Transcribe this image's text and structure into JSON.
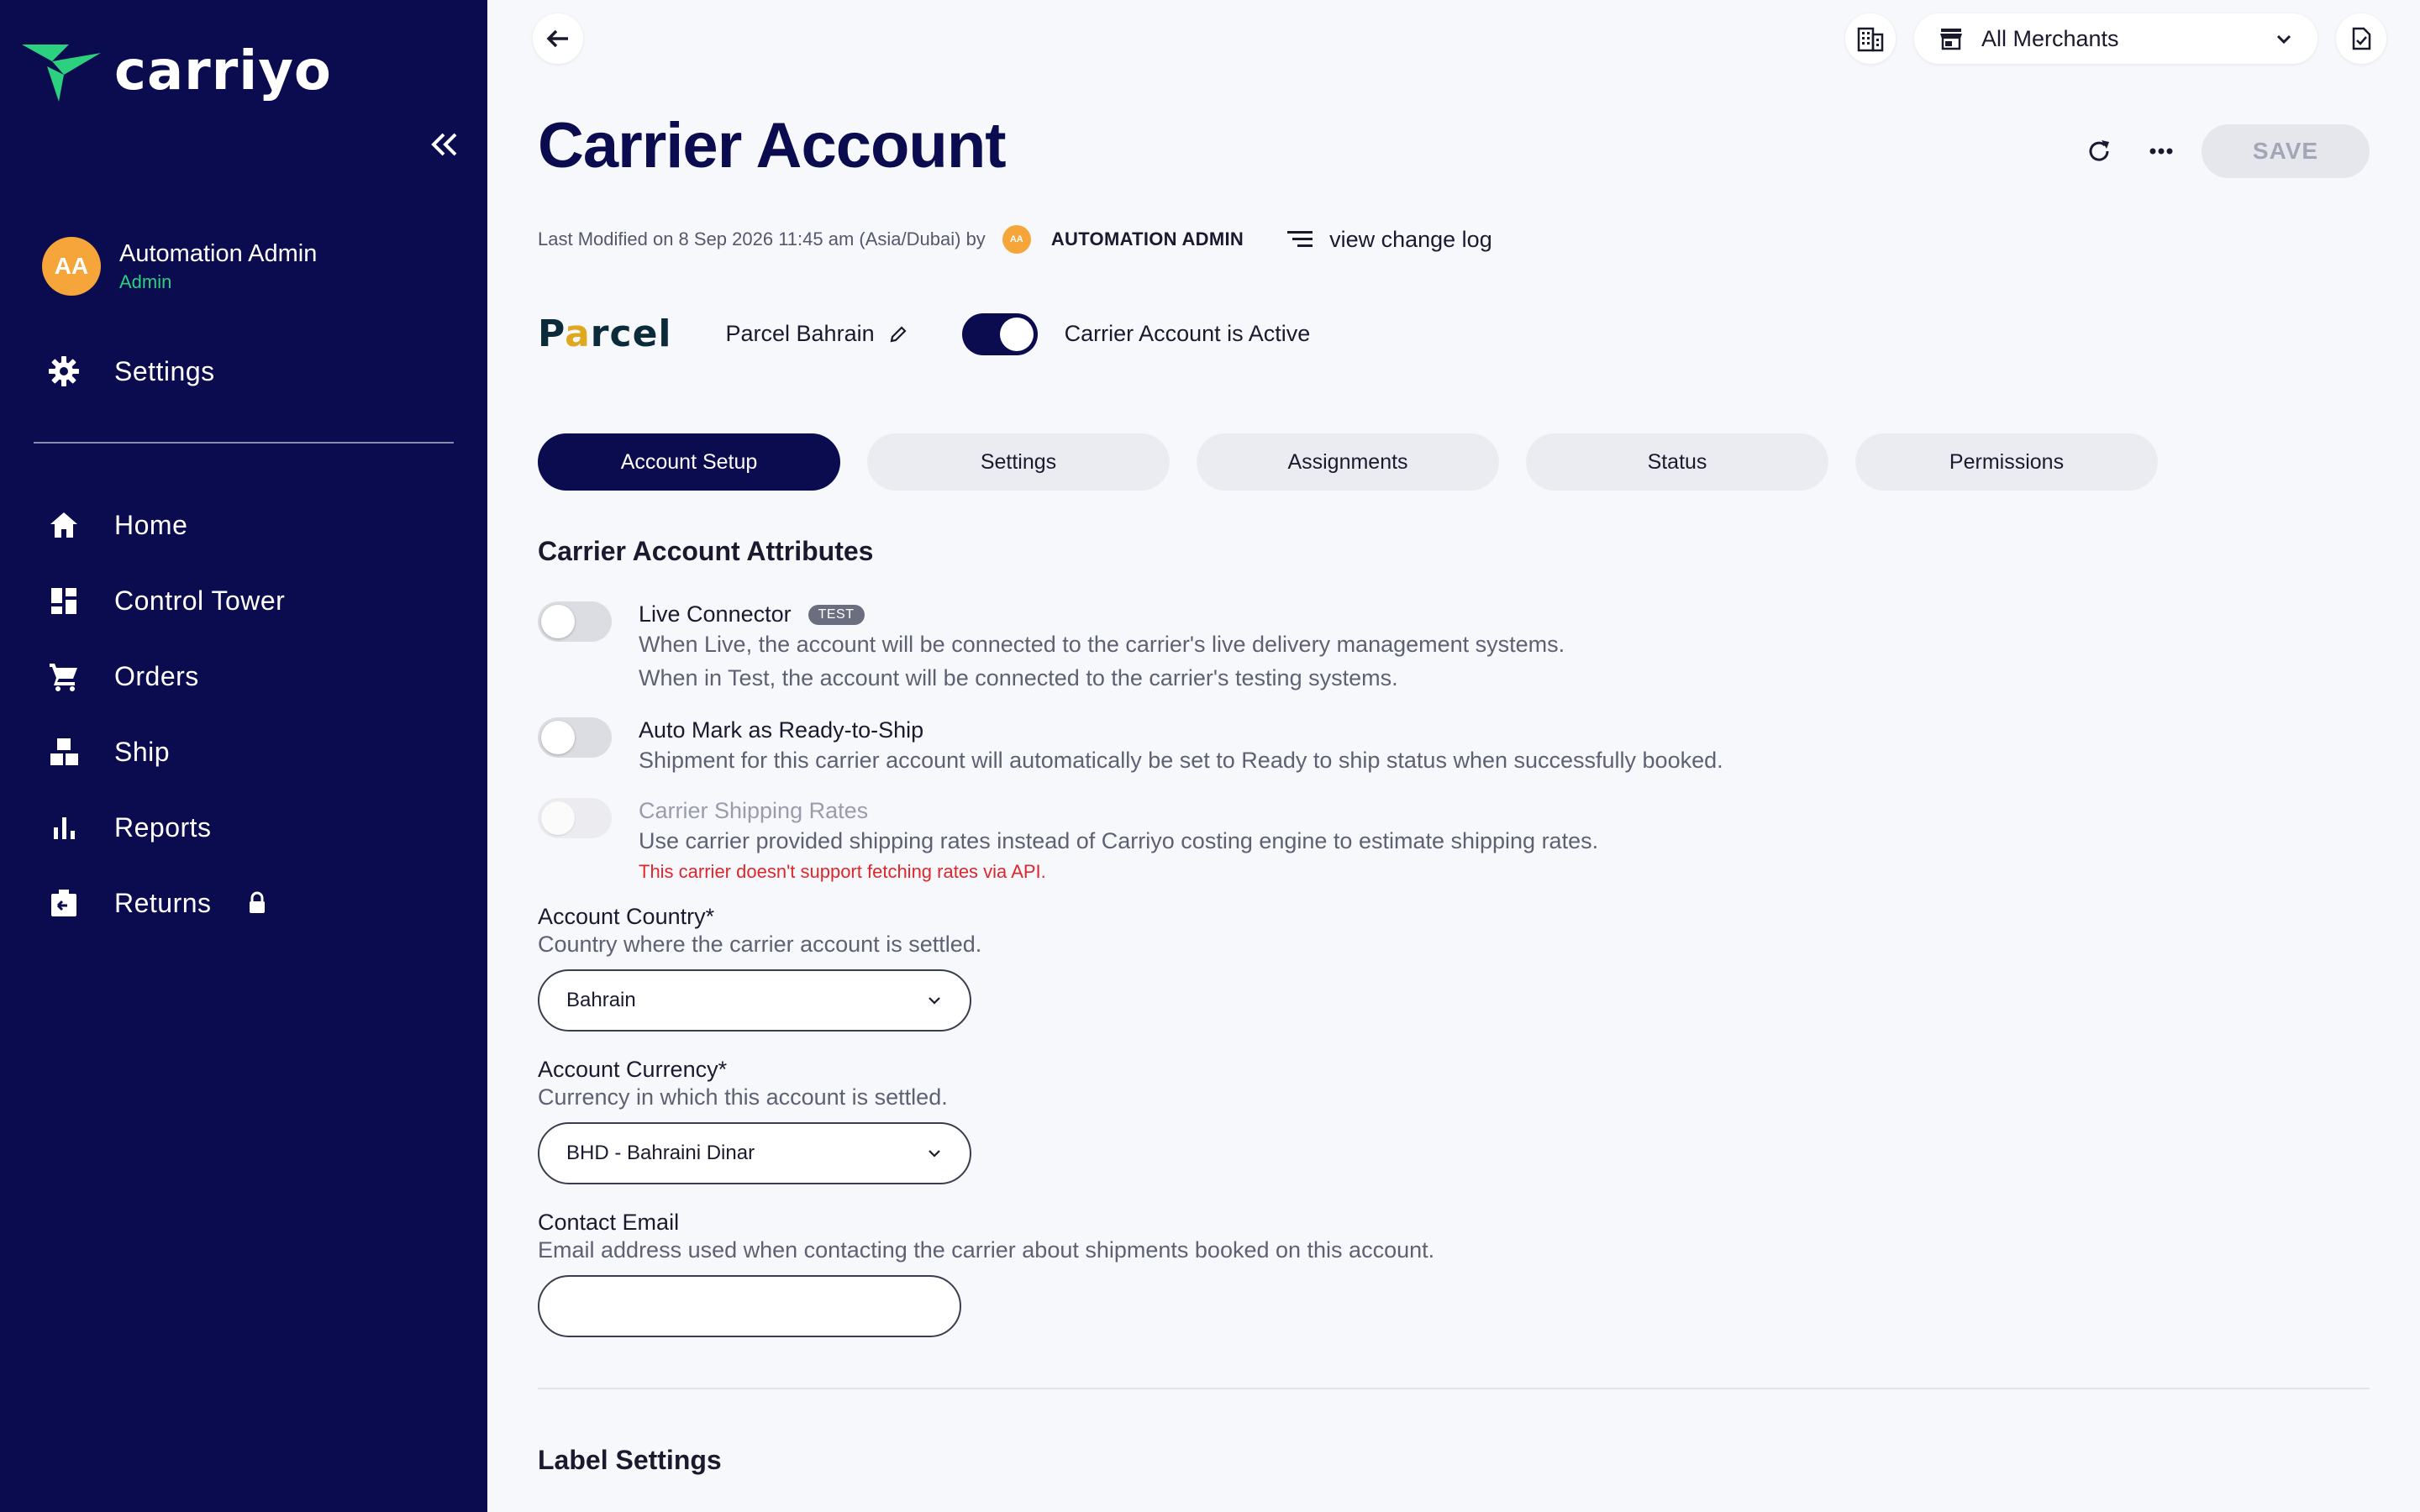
{
  "app": {
    "brand": "carriyo"
  },
  "sidebar": {
    "user": {
      "initials": "AA",
      "name": "Automation Admin",
      "role": "Admin"
    },
    "settings_label": "Settings",
    "items": [
      {
        "label": "Home",
        "icon": "home-icon"
      },
      {
        "label": "Control Tower",
        "icon": "dashboard-icon"
      },
      {
        "label": "Orders",
        "icon": "cart-icon"
      },
      {
        "label": "Ship",
        "icon": "boxes-icon"
      },
      {
        "label": "Reports",
        "icon": "bar-chart-icon"
      },
      {
        "label": "Returns",
        "icon": "return-box-icon",
        "locked": true
      }
    ]
  },
  "topbar": {
    "merchant_label": "All Merchants"
  },
  "header": {
    "title": "Carrier Account",
    "save_label": "SAVE",
    "modified_text": "Last Modified on 8 Sep 2026 11:45 am (Asia/Dubai) by",
    "modified_initials": "AA",
    "modified_by": "AUTOMATION ADMIN",
    "changelog_label": "view change log"
  },
  "carrier": {
    "logo_text_a": "P",
    "logo_text_b": "a",
    "logo_text_c": "rcel",
    "name": "Parcel Bahrain",
    "active_label": "Carrier Account is Active",
    "active": true
  },
  "tabs": [
    {
      "label": "Account Setup",
      "active": true
    },
    {
      "label": "Settings",
      "active": false
    },
    {
      "label": "Assignments",
      "active": false
    },
    {
      "label": "Status",
      "active": false
    },
    {
      "label": "Permissions",
      "active": false
    }
  ],
  "attributes": {
    "section_title": "Carrier Account Attributes",
    "live_connector": {
      "title": "Live Connector",
      "badge": "TEST",
      "desc1": "When Live, the account will be connected to the carrier's live delivery management systems.",
      "desc2": "When in Test, the account will be connected to the carrier's testing systems."
    },
    "auto_mark": {
      "title": "Auto Mark as Ready-to-Ship",
      "desc": "Shipment for this carrier account will automatically be set to Ready to ship status when successfully booked."
    },
    "shipping_rates": {
      "title": "Carrier Shipping Rates",
      "desc": "Use carrier provided shipping rates instead of Carriyo costing engine to estimate shipping rates.",
      "warning": "This carrier doesn't support fetching rates via API."
    }
  },
  "fields": {
    "country": {
      "label": "Account Country*",
      "help": "Country where the carrier account is settled.",
      "value": "Bahrain"
    },
    "currency": {
      "label": "Account Currency*",
      "help": "Currency in which this account is settled.",
      "value": "BHD - Bahraini Dinar"
    },
    "email": {
      "label": "Contact Email",
      "help": "Email address used when contacting the carrier about shipments booked on this account.",
      "value": ""
    }
  },
  "label_settings": {
    "title": "Label Settings"
  },
  "colors": {
    "sidebar": "#0b0b4f",
    "accent": "#0b0b4f",
    "brand_green": "#2bd17e",
    "avatar": "#f5a53a",
    "warning": "#e0262b"
  }
}
